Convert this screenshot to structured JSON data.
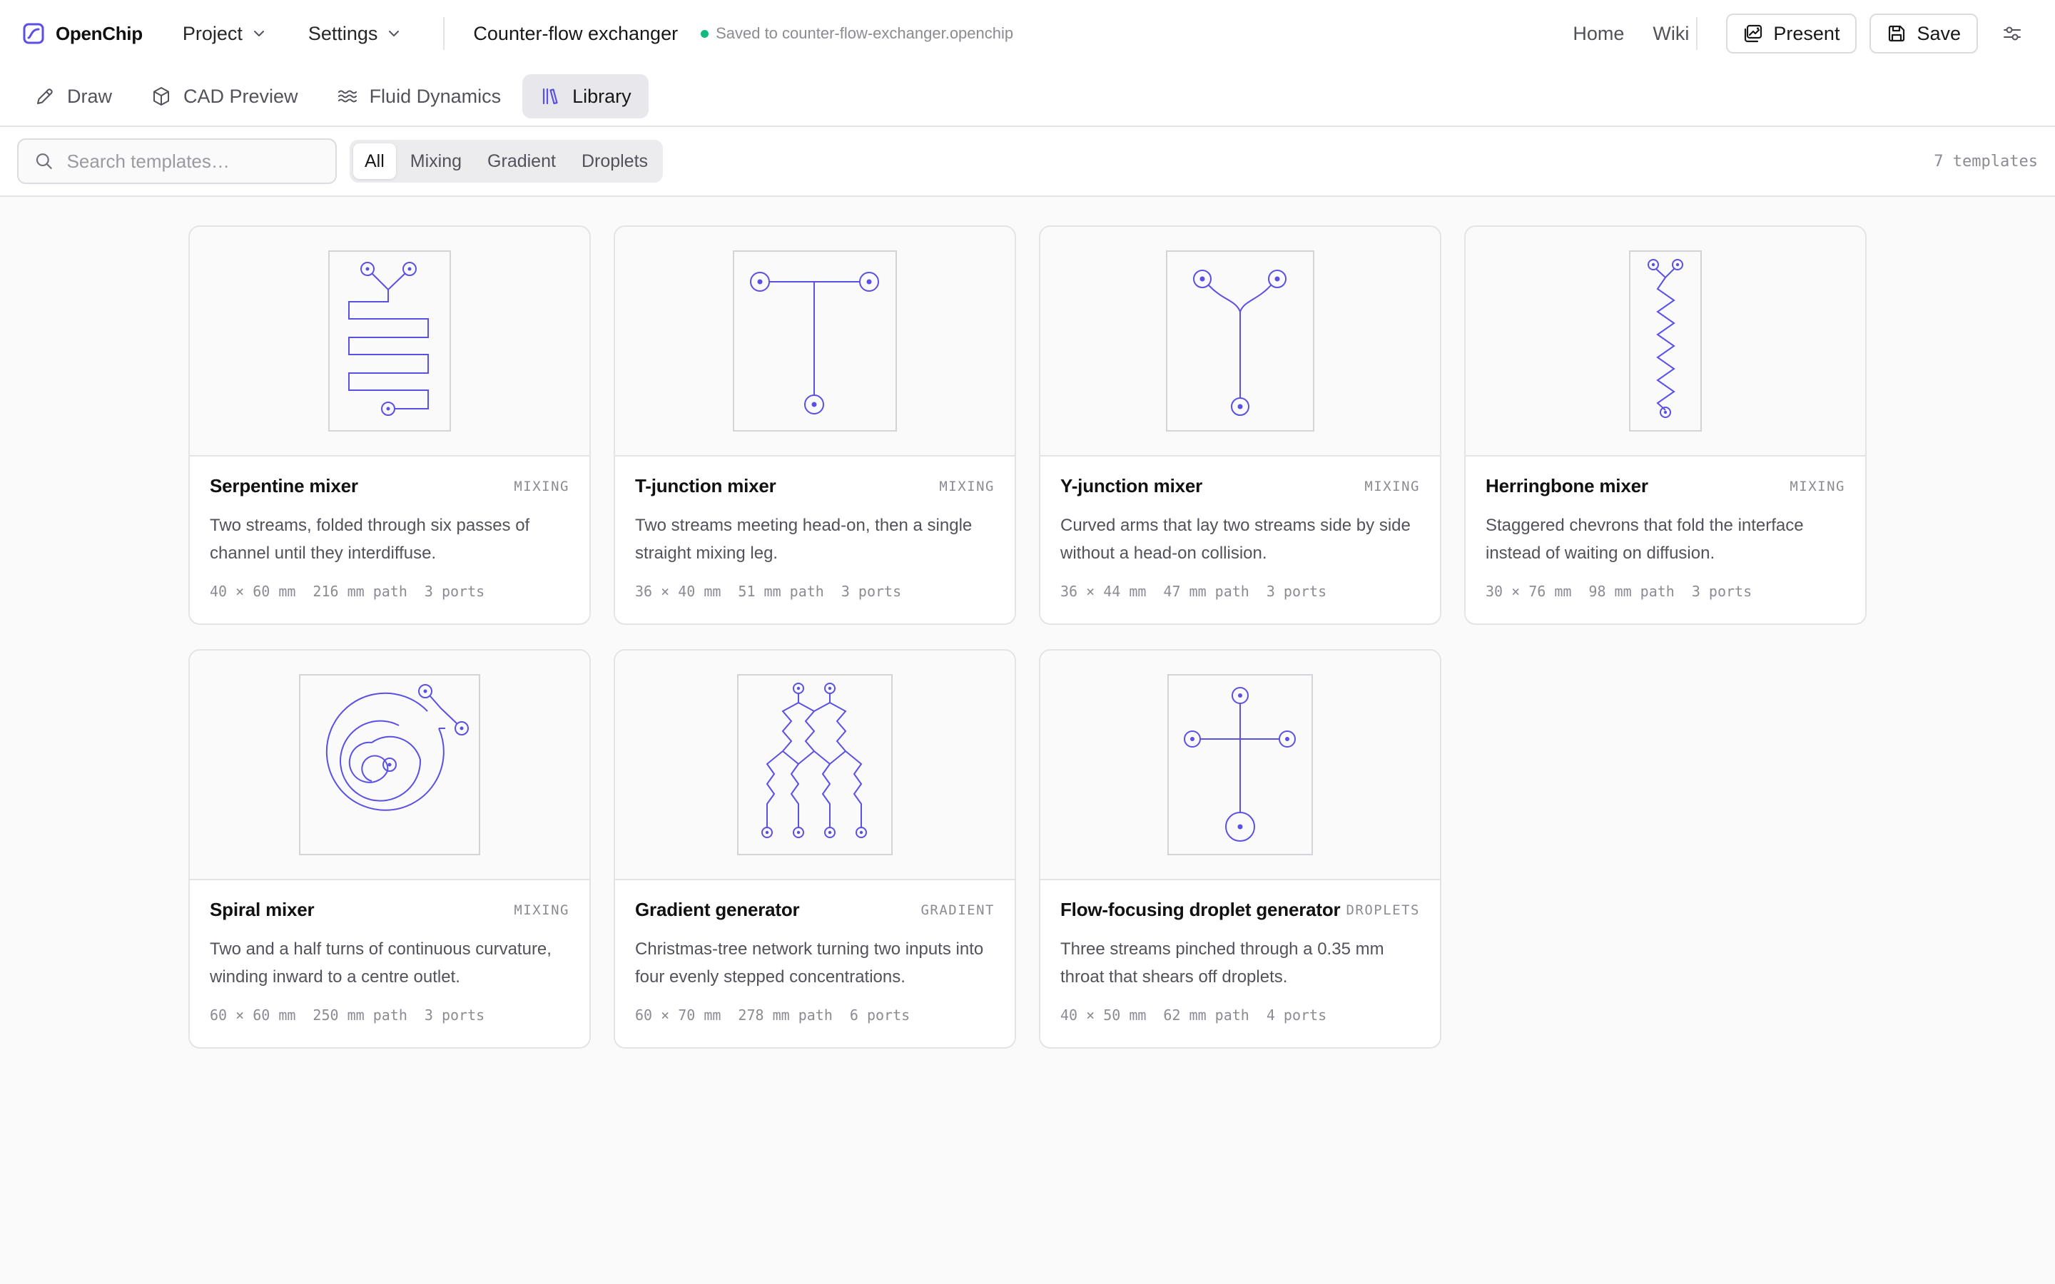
{
  "app": {
    "name": "OpenChip"
  },
  "menus": {
    "project": "Project",
    "settings": "Settings"
  },
  "document": {
    "title": "Counter-flow exchanger",
    "status": "Saved to counter-flow-exchanger.openchip"
  },
  "header_links": {
    "home": "Home",
    "wiki": "Wiki"
  },
  "actions": {
    "present": "Present",
    "save": "Save"
  },
  "tabs": [
    {
      "label": "Draw",
      "icon": "pencil-icon"
    },
    {
      "label": "CAD Preview",
      "icon": "cube-icon"
    },
    {
      "label": "Fluid Dynamics",
      "icon": "waves-icon"
    },
    {
      "label": "Library",
      "icon": "library-icon",
      "active": true
    }
  ],
  "search": {
    "placeholder": "Search templates…"
  },
  "filters": [
    {
      "label": "All",
      "active": true
    },
    {
      "label": "Mixing"
    },
    {
      "label": "Gradient"
    },
    {
      "label": "Droplets"
    }
  ],
  "template_count": "7 templates",
  "accent_color": "#5b50e6",
  "templates": [
    {
      "title": "Serpentine mixer",
      "category": "MIXING",
      "description": "Two streams, folded through six passes of channel until they interdiffuse.",
      "size": "40 × 60 mm",
      "path": "216 mm path",
      "ports": "3 ports"
    },
    {
      "title": "T-junction mixer",
      "category": "MIXING",
      "description": "Two streams meeting head-on, then a single straight mixing leg.",
      "size": "36 × 40 mm",
      "path": "51 mm path",
      "ports": "3 ports"
    },
    {
      "title": "Y-junction mixer",
      "category": "MIXING",
      "description": "Curved arms that lay two streams side by side without a head-on collision.",
      "size": "36 × 44 mm",
      "path": "47 mm path",
      "ports": "3 ports"
    },
    {
      "title": "Herringbone mixer",
      "category": "MIXING",
      "description": "Staggered chevrons that fold the interface instead of waiting on diffusion.",
      "size": "30 × 76 mm",
      "path": "98 mm path",
      "ports": "3 ports"
    },
    {
      "title": "Spiral mixer",
      "category": "MIXING",
      "description": "Two and a half turns of continuous curvature, winding inward to a centre outlet.",
      "size": "60 × 60 mm",
      "path": "250 mm path",
      "ports": "3 ports"
    },
    {
      "title": "Gradient generator",
      "category": "GRADIENT",
      "description": "Christmas-tree network turning two inputs into four evenly stepped concentrations.",
      "size": "60 × 70 mm",
      "path": "278 mm path",
      "ports": "6 ports"
    },
    {
      "title": "Flow-focusing droplet generator",
      "category": "DROPLETS",
      "description": "Three streams pinched through a 0.35 mm throat that shears off droplets.",
      "size": "40 × 50 mm",
      "path": "62 mm path",
      "ports": "4 ports"
    }
  ]
}
